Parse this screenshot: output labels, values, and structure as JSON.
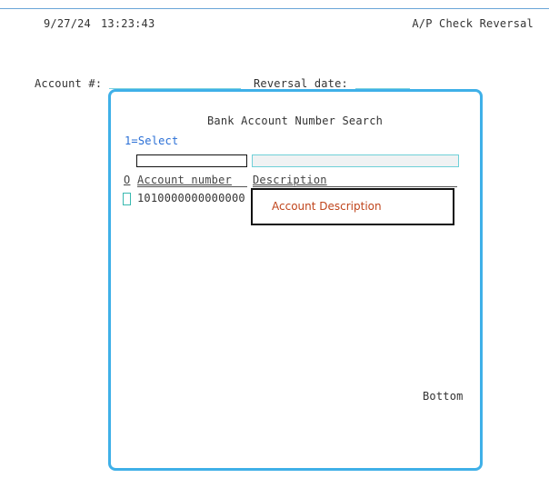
{
  "header": {
    "date": "9/27/24",
    "time": "13:23:43",
    "title": "A/P Check Reversal"
  },
  "form": {
    "account_label": "Account #:",
    "reversal_date_label": "Reversal date:"
  },
  "dialog": {
    "title": "Bank Account Number Search",
    "option_hint": "1=Select",
    "columns": {
      "opt": "O",
      "account": "Account number",
      "description": "Description"
    },
    "rows": [
      {
        "account": "1010000000000000"
      }
    ],
    "tooltip": "Account Description",
    "footer": "Bottom"
  },
  "colors": {
    "accent": "#3fb0e8",
    "select_hint": "#2a6fd6",
    "tooltip_text": "#c0451c"
  }
}
